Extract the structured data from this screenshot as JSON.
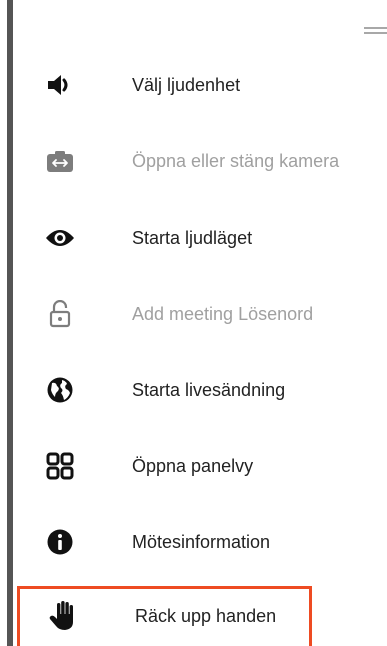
{
  "menu": {
    "items": [
      {
        "label": "Välj ljudenhet",
        "icon": "speaker-icon",
        "enabled": true
      },
      {
        "label": "Öppna eller stäng kamera",
        "icon": "camera-switch-icon",
        "enabled": false
      },
      {
        "label": "Starta ljudläget",
        "icon": "eye-icon",
        "enabled": true
      },
      {
        "label": "Add meeting Lösenord",
        "icon": "unlock-icon",
        "enabled": false
      },
      {
        "label": "Starta livesändning",
        "icon": "globe-icon",
        "enabled": true
      },
      {
        "label": "Öppna panelvy",
        "icon": "grid-icon",
        "enabled": true
      },
      {
        "label": "Mötesinformation",
        "icon": "info-icon",
        "enabled": true
      },
      {
        "label": "Räck upp handen",
        "icon": "raise-hand-icon",
        "enabled": true,
        "highlighted": true
      }
    ]
  },
  "colors": {
    "text": "#222222",
    "disabled": "#a0a0a0",
    "highlight_border": "#ee4b22",
    "rail": "#555555"
  }
}
